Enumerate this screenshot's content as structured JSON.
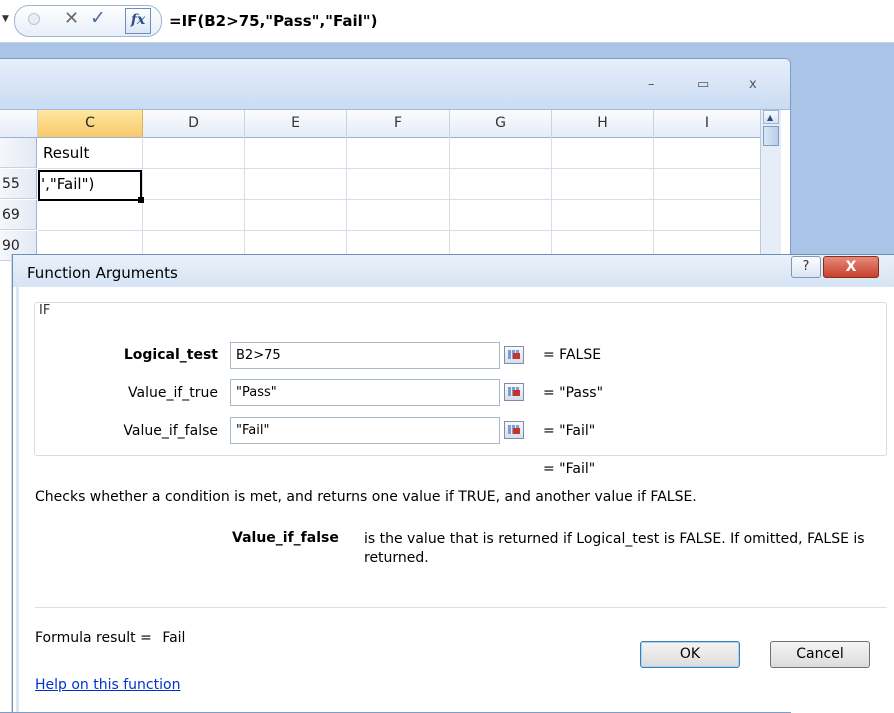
{
  "formula_bar": {
    "fx_label": "fx",
    "cancel_glyph": "✕",
    "enter_glyph": "✓",
    "formula": "=IF(B2>75,\"Pass\",\"Fail\")"
  },
  "workbook": {
    "controls": {
      "minimize": "–",
      "restore": "▭",
      "close": "x"
    },
    "columns": [
      "C",
      "D",
      "E",
      "F",
      "G",
      "H",
      "I"
    ],
    "selected_column": "C",
    "rows": [
      {
        "num": "",
        "c": "Result"
      },
      {
        "num": "55",
        "c": "',\"Fail\")"
      },
      {
        "num": "69",
        "c": ""
      },
      {
        "num": "90",
        "c": ""
      }
    ]
  },
  "dialog": {
    "title": "Function Arguments",
    "help_glyph": "?",
    "close_glyph": "X",
    "function_name": "IF",
    "args": [
      {
        "label": "Logical_test",
        "value": "B2>75",
        "result": "=  FALSE",
        "bold": true
      },
      {
        "label": "Value_if_true",
        "value": "\"Pass\"",
        "result": "=  \"Pass\"",
        "bold": false
      },
      {
        "label": "Value_if_false",
        "value": "\"Fail\"",
        "result": "=  \"Fail\"",
        "bold": false
      }
    ],
    "total_result": "=  \"Fail\"",
    "description": "Checks whether a condition is met, and returns one value if TRUE, and another value if FALSE.",
    "arg_desc_name": "Value_if_false",
    "arg_desc_text": "is the value that is returned if Logical_test is FALSE. If omitted, FALSE is returned.",
    "formula_result_label": "Formula result =",
    "formula_result_value": "Fail",
    "help_link": "Help on this function",
    "ok_label": "OK",
    "cancel_label": "Cancel"
  }
}
